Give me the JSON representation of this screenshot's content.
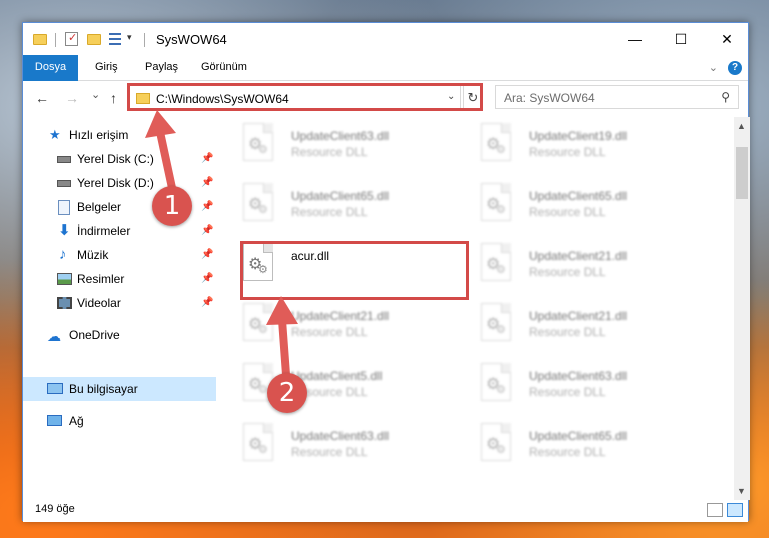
{
  "window": {
    "title": "SysWOW64",
    "controls": {
      "minimize": "—",
      "maximize": "☐",
      "close": "✕"
    }
  },
  "ribbon": {
    "tabs": [
      "Dosya",
      "Giriş",
      "Paylaş",
      "Görünüm"
    ],
    "help": "?"
  },
  "nav": {
    "back": "←",
    "forward": "→",
    "recent": "⌄",
    "up": "↑",
    "address": "C:\\Windows\\SysWOW64",
    "refresh": "↻",
    "search_placeholder": "Ara: SysWOW64"
  },
  "sidebar": {
    "items": [
      {
        "label": "Hızlı erişim",
        "icon": "star-icon",
        "pinned": false
      },
      {
        "label": "Yerel Disk (C:)",
        "icon": "drive-icon",
        "pinned": true
      },
      {
        "label": "Yerel Disk (D:)",
        "icon": "drive-icon",
        "pinned": true
      },
      {
        "label": "Belgeler",
        "icon": "documents-icon",
        "pinned": true
      },
      {
        "label": "İndirmeler",
        "icon": "downloads-icon",
        "pinned": true
      },
      {
        "label": "Müzik",
        "icon": "music-icon",
        "pinned": true
      },
      {
        "label": "Resimler",
        "icon": "pictures-icon",
        "pinned": true
      },
      {
        "label": "Videolar",
        "icon": "videos-icon",
        "pinned": true
      },
      {
        "label": "OneDrive",
        "icon": "onedrive-icon",
        "pinned": false
      },
      {
        "label": "Bu bilgisayar",
        "icon": "computer-icon",
        "pinned": false,
        "selected": true
      },
      {
        "label": "Ağ",
        "icon": "network-icon",
        "pinned": false
      }
    ]
  },
  "files": {
    "left": [
      {
        "name": "UpdateClient63.dll",
        "type": "Resource DLL",
        "blurred": true
      },
      {
        "name": "UpdateClient65.dll",
        "type": "Resource DLL",
        "blurred": true
      },
      {
        "name": "acur.dll",
        "type": "",
        "blurred": false,
        "highlighted": true
      },
      {
        "name": "UpdateClient21.dll",
        "type": "Resource DLL",
        "blurred": true
      },
      {
        "name": "UpdateClient5.dll",
        "type": "Resource DLL",
        "blurred": true
      },
      {
        "name": "UpdateClient63.dll",
        "type": "Resource DLL",
        "blurred": true
      }
    ],
    "right": [
      {
        "name": "UpdateClient19.dll",
        "type": "Resource DLL",
        "blurred": true
      },
      {
        "name": "UpdateClient65.dll",
        "type": "Resource DLL",
        "blurred": true
      },
      {
        "name": "UpdateClient21.dll",
        "type": "Resource DLL",
        "blurred": true
      },
      {
        "name": "UpdateClient21.dll",
        "type": "Resource DLL",
        "blurred": true
      },
      {
        "name": "UpdateClient63.dll",
        "type": "Resource DLL",
        "blurred": true
      },
      {
        "name": "UpdateClient65.dll",
        "type": "Resource DLL",
        "blurred": true
      }
    ]
  },
  "status": {
    "count": "149 öğe"
  },
  "annotations": {
    "step1": "1",
    "step2": "2",
    "color": "#d34a48"
  }
}
